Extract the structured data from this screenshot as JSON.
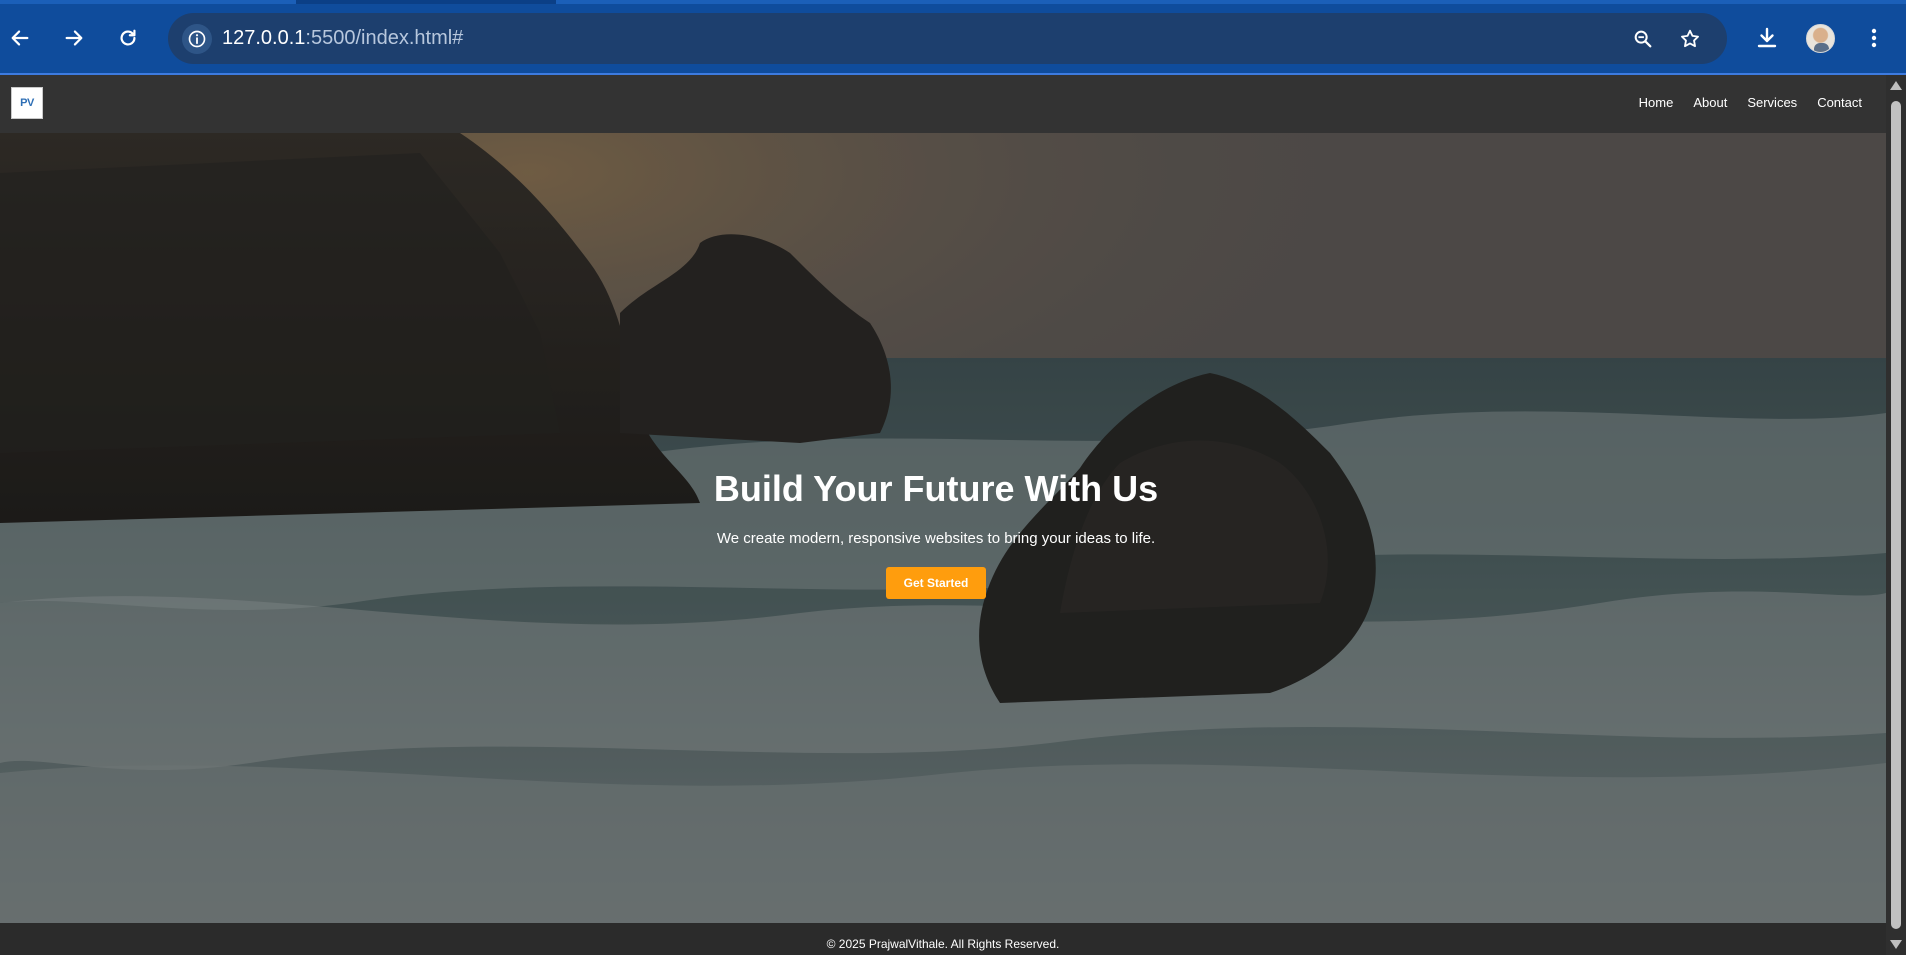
{
  "browser": {
    "url_host": "127.0.0.1",
    "url_rest": ":5500/index.html#",
    "icons": [
      "back-icon",
      "forward-icon",
      "reload-icon",
      "info-icon",
      "zoom-icon",
      "star-icon",
      "download-icon",
      "menu-icon"
    ]
  },
  "site": {
    "logo_text": "PV",
    "nav": [
      {
        "label": "Home"
      },
      {
        "label": "About"
      },
      {
        "label": "Services"
      },
      {
        "label": "Contact"
      }
    ],
    "hero": {
      "title": "Build Your Future With Us",
      "subtitle": "We create modern, responsive websites to bring your ideas to life.",
      "cta_label": "Get Started"
    },
    "footer_text": "© 2025 PrajwalVithale. All Rights Reserved."
  },
  "colors": {
    "chrome_blue": "#0f4c9c",
    "nav_bg": "#333333",
    "accent": "#ff9d0d"
  }
}
